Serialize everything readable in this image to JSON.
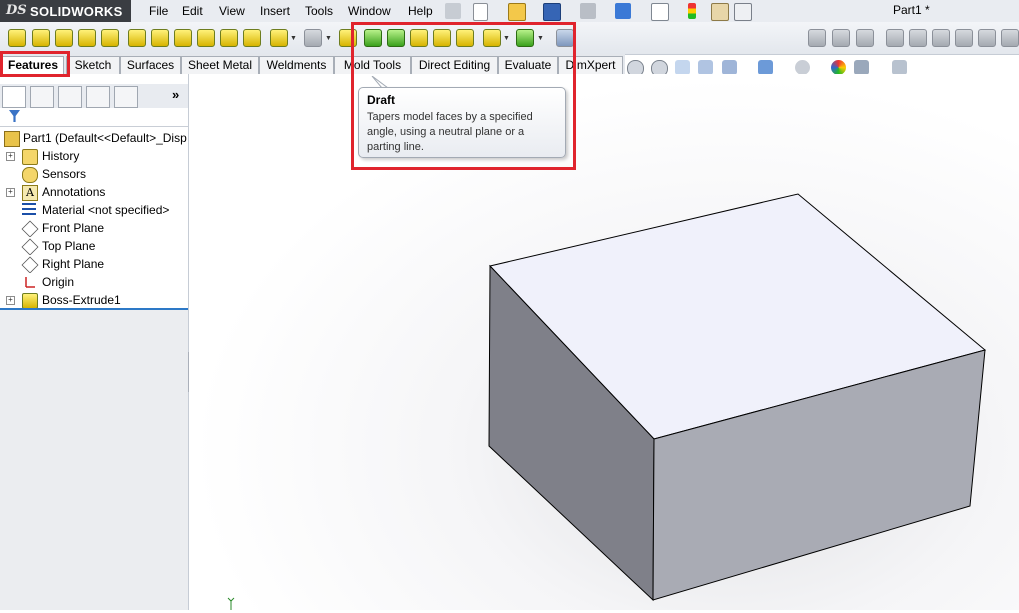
{
  "app": {
    "brand": "SOLIDWORKS",
    "brand_prefix": "DS",
    "document_title": "Part1 *"
  },
  "menu": [
    "File",
    "Edit",
    "View",
    "Insert",
    "Tools",
    "Window",
    "Help"
  ],
  "tabs": [
    {
      "label": "Features",
      "active": true
    },
    {
      "label": "Sketch"
    },
    {
      "label": "Surfaces"
    },
    {
      "label": "Sheet Metal"
    },
    {
      "label": "Weldments"
    },
    {
      "label": "Mold Tools"
    },
    {
      "label": "Direct Editing"
    },
    {
      "label": "Evaluate"
    },
    {
      "label": "DimXpert"
    }
  ],
  "tooltip": {
    "title": "Draft",
    "body": "Tapers model faces by a specified angle, using a neutral plane or a parting line."
  },
  "tree": {
    "root": "Part1  (Default<<Default>_Disp",
    "items": [
      {
        "label": "History",
        "icon": "history-icon",
        "expandable": true
      },
      {
        "label": "Sensors",
        "icon": "sensor-icon",
        "expandable": false
      },
      {
        "label": "Annotations",
        "icon": "annotations-icon",
        "expandable": true
      },
      {
        "label": "Material <not specified>",
        "icon": "material-icon",
        "expandable": false
      },
      {
        "label": "Front Plane",
        "icon": "plane-icon",
        "expandable": false
      },
      {
        "label": "Top Plane",
        "icon": "plane-icon",
        "expandable": false
      },
      {
        "label": "Right Plane",
        "icon": "plane-icon",
        "expandable": false
      },
      {
        "label": "Origin",
        "icon": "origin-icon",
        "expandable": false
      },
      {
        "label": "Boss-Extrude1",
        "icon": "extrude-icon",
        "expandable": true
      }
    ]
  },
  "colors": {
    "highlight_red": "#e0242d",
    "box_top": "#f0f1fb",
    "box_front": "#a9abb4",
    "box_left": "#7f8089",
    "tree_separator": "#2d79c7"
  }
}
